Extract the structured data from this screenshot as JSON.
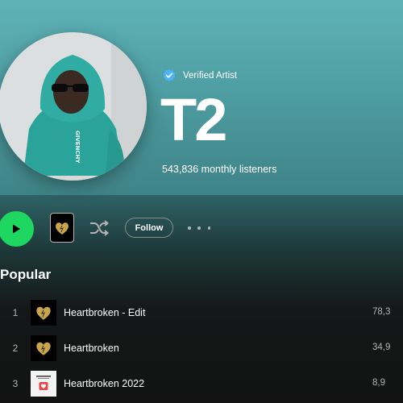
{
  "artist": {
    "verified_label": "Verified Artist",
    "name": "T2",
    "monthly_listeners": "543,836 monthly listeners"
  },
  "actions": {
    "follow_label": "Follow"
  },
  "popular": {
    "title": "Popular",
    "tracks": [
      {
        "number": "1",
        "title": "Heartbroken - Edit",
        "plays": "78,3"
      },
      {
        "number": "2",
        "title": "Heartbroken",
        "plays": "34,9"
      },
      {
        "number": "3",
        "title": "Heartbroken 2022",
        "plays": "8,9"
      }
    ]
  },
  "icons": {
    "verified": "verified-badge-icon",
    "play": "play-icon",
    "shuffle": "shuffle-icon",
    "more": "more-options-icon"
  },
  "colors": {
    "accent_green": "#1ed760",
    "verified_blue": "#4cb3ff",
    "header_teal": "#5fb3b8"
  }
}
